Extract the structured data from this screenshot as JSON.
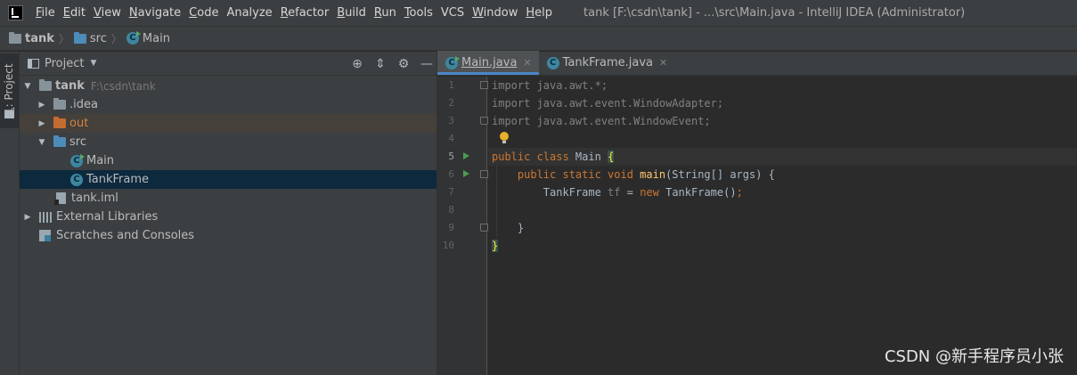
{
  "menubar": {
    "items": [
      {
        "mnemonic": "F",
        "rest": "ile"
      },
      {
        "mnemonic": "E",
        "rest": "dit"
      },
      {
        "mnemonic": "V",
        "rest": "iew"
      },
      {
        "mnemonic": "N",
        "rest": "avigate"
      },
      {
        "mnemonic": "C",
        "rest": "ode"
      },
      {
        "mnemonic": "",
        "rest": "Analyze"
      },
      {
        "mnemonic": "R",
        "rest": "efactor"
      },
      {
        "mnemonic": "B",
        "rest": "uild"
      },
      {
        "mnemonic": "R",
        "rest": "un"
      },
      {
        "mnemonic": "T",
        "rest": "ools"
      },
      {
        "mnemonic": "",
        "rest": "VCS"
      },
      {
        "mnemonic": "W",
        "rest": "indow"
      },
      {
        "mnemonic": "H",
        "rest": "elp"
      }
    ],
    "window_title": "tank [F:\\csdn\\tank] - ...\\src\\Main.java - IntelliJ IDEA (Administrator)"
  },
  "navbar": {
    "project": "tank",
    "folder": "src",
    "file": "Main"
  },
  "toolstrip": {
    "tab_label_num": "1",
    "tab_label_text": ": Project"
  },
  "project_panel": {
    "title": "Project",
    "tree": {
      "root_label": "tank",
      "root_path": "F:\\csdn\\tank",
      "idea": ".idea",
      "out": "out",
      "src": "src",
      "main": "Main",
      "tankframe": "TankFrame",
      "iml": "tank.iml",
      "ext_libs": "External Libraries",
      "scratches": "Scratches and Consoles"
    }
  },
  "editor": {
    "tabs": [
      {
        "label": "Main.java",
        "active": true
      },
      {
        "label": "TankFrame.java",
        "active": false
      }
    ],
    "line_numbers": [
      "1",
      "2",
      "3",
      "4",
      "5",
      "6",
      "7",
      "8",
      "9",
      "10"
    ],
    "current_line": 5,
    "code": {
      "l1a": "import",
      "l1b": " java.awt.*;",
      "l2a": "import",
      "l2b": " java.awt.event.WindowAdapter;",
      "l3a": "import",
      "l3b": " java.awt.event.WindowEvent;",
      "l5a": "public class",
      "l5b": " Main ",
      "l5c": "{",
      "l6a": "    public static void ",
      "l6b": "main",
      "l6c": "(String[] args) {",
      "l7a": "        TankFrame ",
      "l7b": "tf",
      "l7c": " = ",
      "l7d": "new",
      "l7e": " TankFrame()",
      "l7f": ";",
      "l9": "    }",
      "l10": "}"
    }
  },
  "watermark": "CSDN @新手程序员小张"
}
